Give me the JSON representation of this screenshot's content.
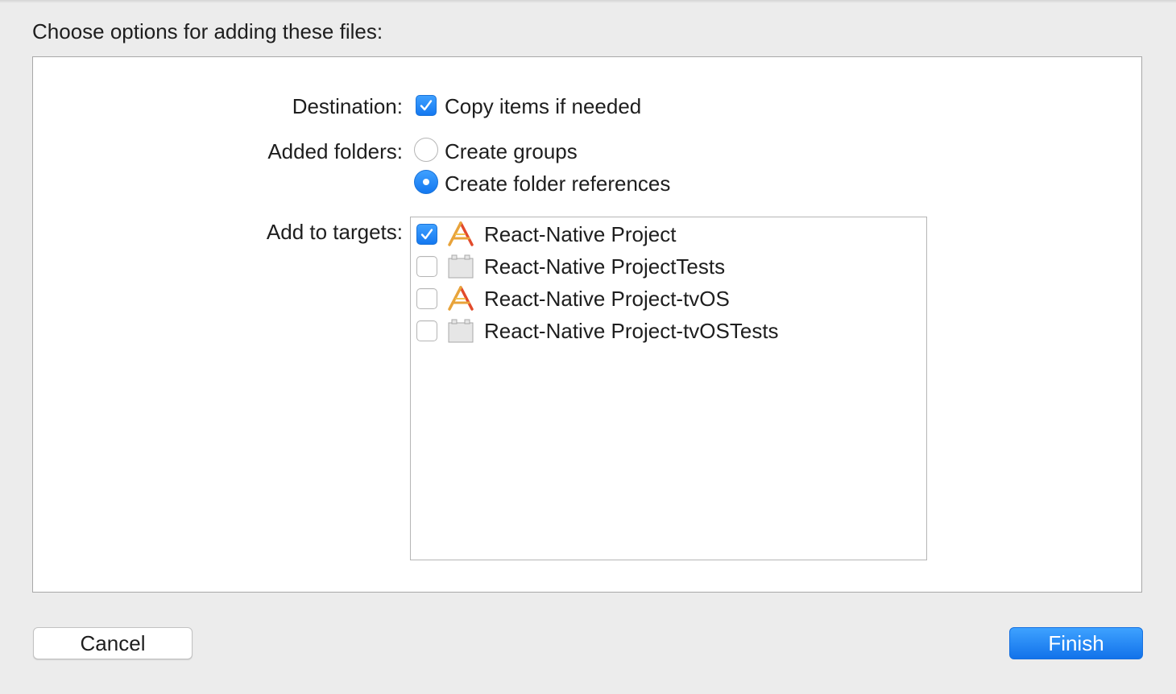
{
  "dialog": {
    "header": "Choose options for adding these files:"
  },
  "destination": {
    "label": "Destination:",
    "copy_items": {
      "label": "Copy items if needed",
      "checked": true
    }
  },
  "added_folders": {
    "label": "Added folders:",
    "options": [
      {
        "label": "Create groups",
        "selected": false
      },
      {
        "label": "Create folder references",
        "selected": true
      }
    ]
  },
  "targets": {
    "label": "Add to targets:",
    "items": [
      {
        "label": "React-Native Project",
        "checked": true,
        "icon": "app-target-icon"
      },
      {
        "label": "React-Native ProjectTests",
        "checked": false,
        "icon": "test-bundle-icon"
      },
      {
        "label": "React-Native Project-tvOS",
        "checked": false,
        "icon": "app-target-icon"
      },
      {
        "label": "React-Native Project-tvOSTests",
        "checked": false,
        "icon": "test-bundle-icon"
      }
    ]
  },
  "buttons": {
    "cancel": "Cancel",
    "finish": "Finish"
  },
  "colors": {
    "accent": "#1478f0",
    "background": "#ececec",
    "panel": "#ffffff"
  }
}
